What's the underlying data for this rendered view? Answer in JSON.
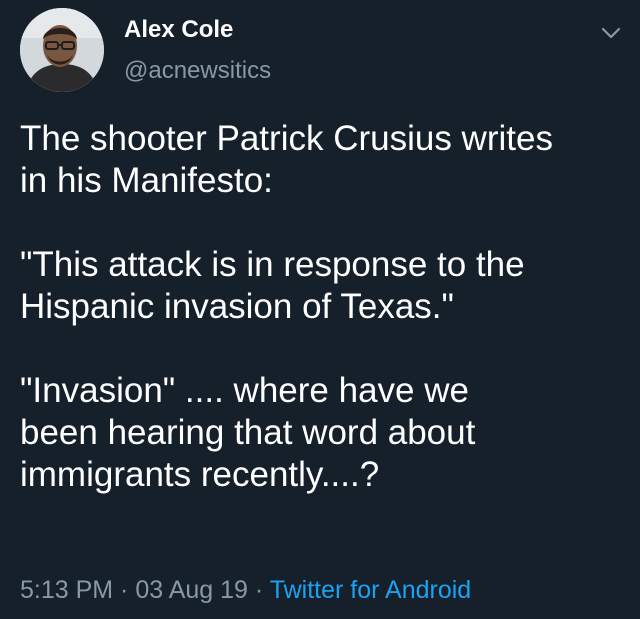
{
  "author": {
    "display_name": "Alex Cole",
    "handle": "@acnewsitics"
  },
  "tweet": {
    "paragraphs": [
      "The shooter Patrick Crusius writes\nin his Manifesto:",
      "\"This attack is in response to the\nHispanic invasion of Texas.\"",
      "\"Invasion\" .... where have we\nbeen hearing that word about\nimmigrants recently....?"
    ],
    "time": "5:13 PM",
    "separator": " · ",
    "date": "03 Aug 19",
    "source": "Twitter for Android"
  },
  "icons": {
    "avatar": "profile-photo",
    "caret": "chevron-down-icon"
  },
  "colors": {
    "background": "#15202b",
    "text": "#ffffff",
    "secondary": "#8899a6",
    "link": "#1da1f2"
  }
}
